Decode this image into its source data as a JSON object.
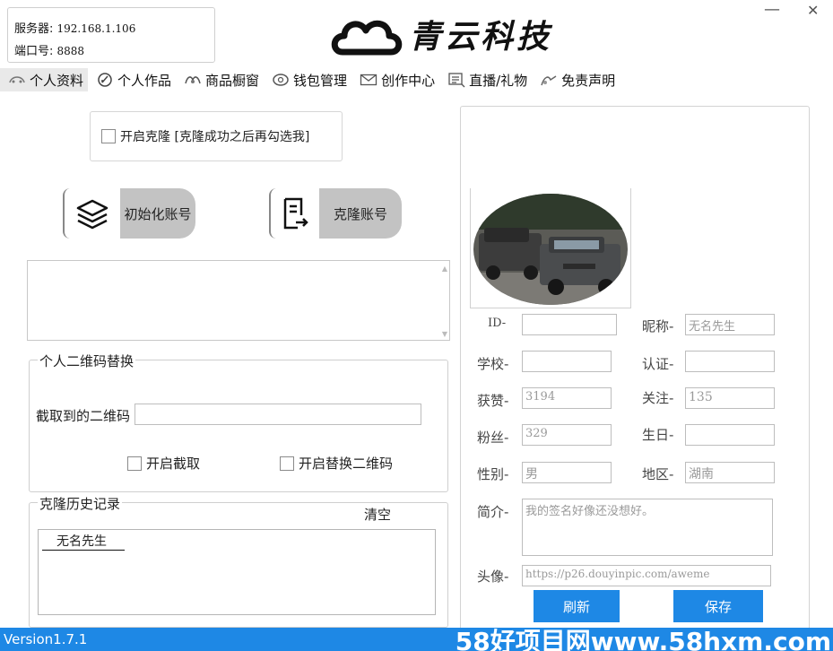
{
  "server": {
    "label": "服务器:",
    "ip": "192.168.1.106",
    "port_label": "端口号:",
    "port": "8888"
  },
  "brand": {
    "name": "青云科技"
  },
  "window": {
    "minimize": "—",
    "close": "✕"
  },
  "tabs": [
    {
      "label": "个人资料",
      "icon": "profile-icon",
      "active": true
    },
    {
      "label": "个人作品",
      "icon": "works-icon"
    },
    {
      "label": "商品橱窗",
      "icon": "shop-window-icon"
    },
    {
      "label": "钱包管理",
      "icon": "wallet-icon"
    },
    {
      "label": "创作中心",
      "icon": "envelope-icon"
    },
    {
      "label": "直播/礼物",
      "icon": "live-icon"
    },
    {
      "label": "免责声明",
      "icon": "disclaimer-icon"
    }
  ],
  "clone": {
    "enable_label": "开启克隆 [克隆成功之后再勾选我]",
    "init_button": "初始化账号",
    "clone_button": "克隆账号"
  },
  "qr": {
    "group_title": "个人二维码替换",
    "captured_label": "截取到的二维码",
    "captured_value": "",
    "enable_capture": "开启截取",
    "enable_replace": "开启替换二维码"
  },
  "history": {
    "group_title": "克隆历史记录",
    "clear_label": "清空",
    "items": [
      "无名先生"
    ]
  },
  "profile": {
    "id_label": "ID-",
    "id_value": "",
    "nickname_label": "昵称-",
    "nickname_value": "无名先生",
    "school_label": "学校-",
    "school_value": "",
    "verify_label": "认证-",
    "verify_value": "",
    "likes_label": "获赞-",
    "likes_value": "3194",
    "following_label": "关注-",
    "following_value": "135",
    "fans_label": "粉丝-",
    "fans_value": "329",
    "birthday_label": "生日-",
    "birthday_value": "",
    "gender_label": "性别-",
    "gender_value": "男",
    "region_label": "地区-",
    "region_value": "湖南",
    "bio_label": "简介-",
    "bio_value": "我的签名好像还没想好。",
    "avatar_label": "头像-",
    "avatar_value": "https://p26.douyinpic.com/aweme",
    "refresh_button": "刷新",
    "save_button": "保存"
  },
  "status": {
    "version": "Version1.7.1",
    "watermark": "58好项目网www.58hxm.com"
  },
  "colors": {
    "accent": "#1e88e5",
    "button_gray": "#c3c3c3"
  }
}
